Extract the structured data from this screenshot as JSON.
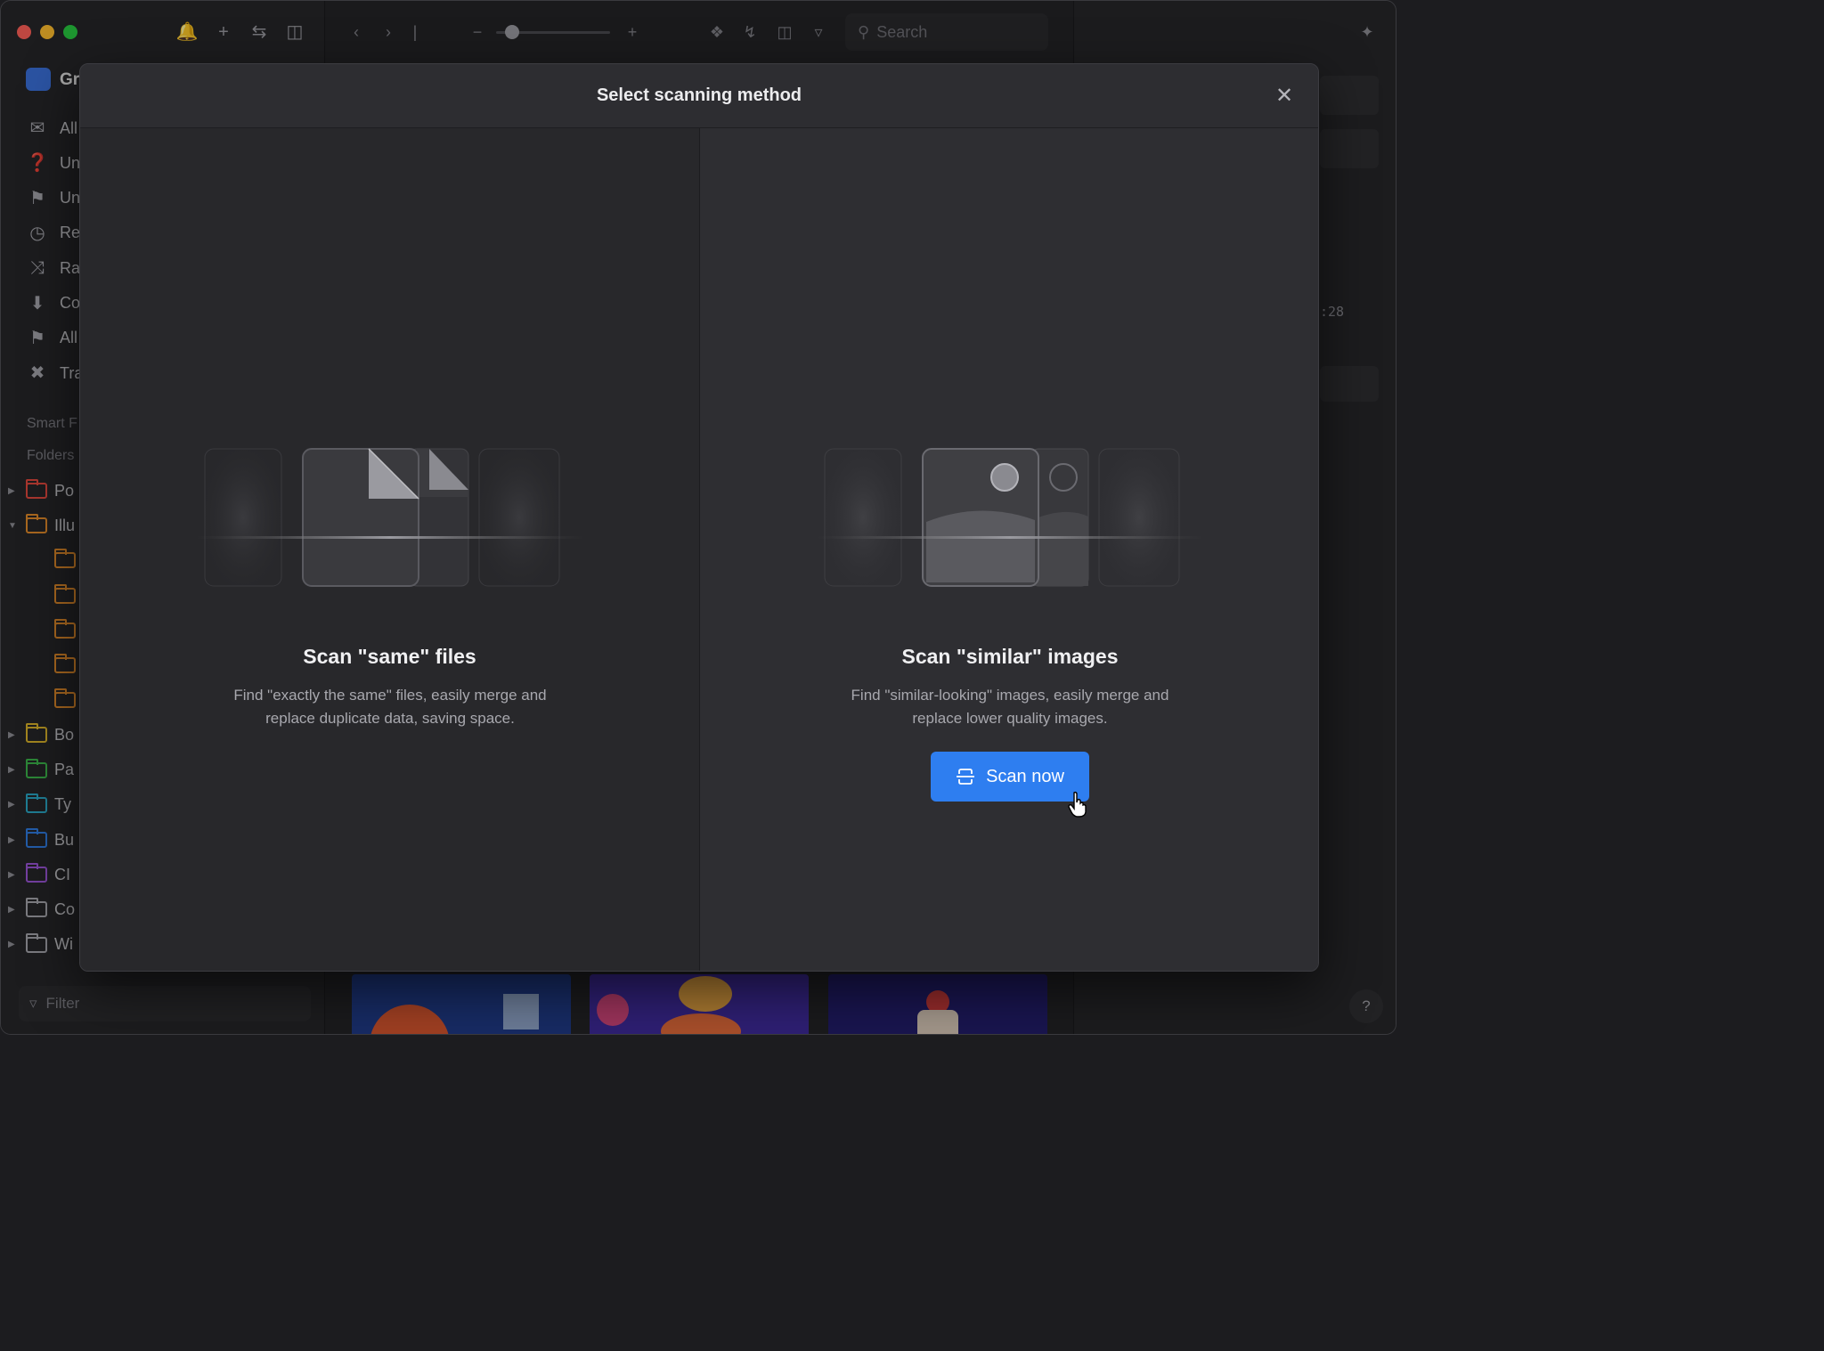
{
  "app": {
    "library_name_partial": "Gr",
    "colors": {
      "accent": "#2e7ef0",
      "traffic_red": "#fe5f57",
      "traffic_yellow": "#febc2e",
      "traffic_green": "#28c840"
    }
  },
  "sidebar": {
    "nav_items": [
      {
        "label": "All",
        "icon": "inbox-icon"
      },
      {
        "label": "Un",
        "icon": "folder-question-icon"
      },
      {
        "label": "Un",
        "icon": "tag-question-icon"
      },
      {
        "label": "Re",
        "icon": "clock-icon"
      },
      {
        "label": "Ra",
        "icon": "shuffle-icon"
      },
      {
        "label": "Co",
        "icon": "archive-icon"
      },
      {
        "label": "All",
        "icon": "bookmark-icon"
      },
      {
        "label": "Tra",
        "icon": "trash-icon"
      }
    ],
    "section_smart": "Smart F",
    "section_folders": "Folders",
    "folders": [
      {
        "label": "Po",
        "color": "#e0483e",
        "expanded": false
      },
      {
        "label": "Illu",
        "color": "#e08a2a",
        "expanded": true
      },
      {
        "label": "",
        "color": "#e08a2a",
        "child": true
      },
      {
        "label": "",
        "color": "#e08a2a",
        "child": true
      },
      {
        "label": "",
        "color": "#e08a2a",
        "child": true
      },
      {
        "label": "",
        "color": "#e08a2a",
        "child": true
      },
      {
        "label": "",
        "color": "#e08a2a",
        "child": true
      },
      {
        "label": "Bo",
        "color": "#d8b22a",
        "expanded": false
      },
      {
        "label": "Pa",
        "color": "#3bb34a",
        "expanded": false
      },
      {
        "label": "Ty",
        "color": "#2aa6c4",
        "expanded": false
      },
      {
        "label": "Bu",
        "color": "#2f7be0",
        "expanded": false
      },
      {
        "label": "CI",
        "color": "#9a55d6",
        "expanded": false
      },
      {
        "label": "Co",
        "color": "#a5a5ab",
        "expanded": false
      },
      {
        "label": "Wi",
        "color": "#a5a5ab",
        "expanded": false
      }
    ],
    "filter_placeholder": "Filter"
  },
  "toolbar": {
    "search_placeholder": "Search",
    "zoom_value": 0.15
  },
  "inspector": {
    "time_partial": ":28"
  },
  "modal": {
    "title": "Select scanning method",
    "left": {
      "heading": "Scan \"same\" files",
      "description": "Find \"exactly the same\" files, easily merge and replace duplicate data, saving space."
    },
    "right": {
      "heading": "Scan \"similar\" images",
      "description": "Find \"similar-looking\" images, easily merge and replace lower quality images.",
      "button_label": "Scan now"
    }
  }
}
